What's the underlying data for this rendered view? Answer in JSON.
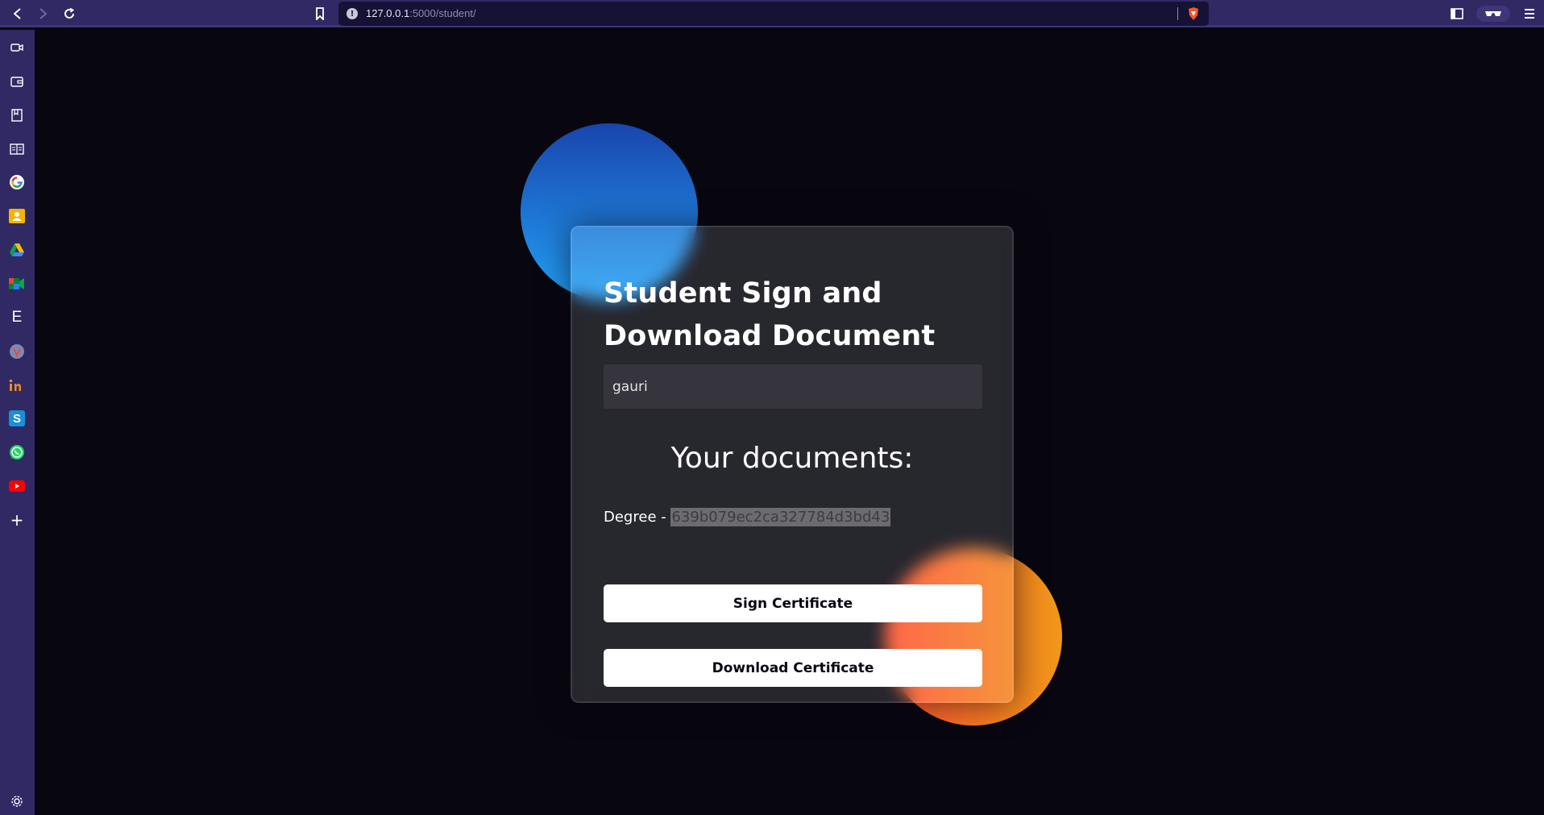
{
  "browser": {
    "url_host": "127.0.0.1",
    "url_path": ":5000/student/",
    "url_info_glyph": "!",
    "sidebar_icons": [
      "video-call-icon",
      "wallet-icon",
      "bookmarks-icon",
      "reading-list-icon",
      "google-icon",
      "contacts-icon",
      "drive-icon",
      "meet-icon",
      "e-icon",
      "brave-talk-icon",
      "indeed-icon",
      "s-app-icon",
      "whatsapp-icon",
      "youtube-icon",
      "add-icon"
    ],
    "sidebar_e_letter": "E",
    "sidebar_s_letter": "S",
    "sidebar_add_glyph": "+"
  },
  "card": {
    "title": "Student Sign and Download Document",
    "name_value": "gauri",
    "docs_heading": "Your documents:",
    "doc_label": "Degree - ",
    "doc_hash": "639b079ec2ca327784d3bd43",
    "sign_button": "Sign Certificate",
    "download_button": "Download Certificate"
  },
  "colors": {
    "background": "#080710",
    "browser_chrome": "#312964",
    "blue_gradient": [
      "#1845ad",
      "#23a2f6"
    ],
    "orange_gradient": [
      "#ff512f",
      "#f09819"
    ],
    "button_bg": "#ffffff"
  }
}
